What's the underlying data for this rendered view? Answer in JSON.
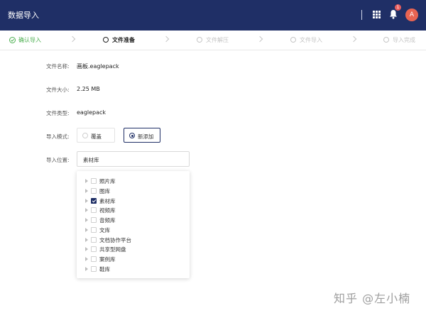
{
  "header": {
    "title": "数据导入",
    "notification_count": "1",
    "avatar_initial": "A",
    "colors": {
      "bg": "#1f2f66",
      "badge": "#e85d5d",
      "avatar": "#e86452"
    },
    "icons": [
      "grid-icon",
      "bell-icon"
    ]
  },
  "steps": [
    {
      "label": "确认导入",
      "state": "done"
    },
    {
      "label": "文件准备",
      "state": "active"
    },
    {
      "label": "文件解压",
      "state": "pending"
    },
    {
      "label": "文件导入",
      "state": "pending"
    },
    {
      "label": "导入完成",
      "state": "pending"
    }
  ],
  "form": {
    "file_name_label": "文件名称:",
    "file_name": "画板.eaglepack",
    "file_size_label": "文件大小:",
    "file_size": "2.25 MB",
    "file_type_label": "文件类型:",
    "file_type": "eaglepack",
    "mode_label": "导入模式:",
    "mode_options": [
      {
        "label": "覆盖",
        "selected": false
      },
      {
        "label": "新添加",
        "selected": true
      }
    ],
    "location_label": "导入位置:",
    "location_value": "素材库"
  },
  "tree": {
    "items": [
      {
        "label": "照片库",
        "checked": false
      },
      {
        "label": "图库",
        "checked": false
      },
      {
        "label": "素材库",
        "checked": true
      },
      {
        "label": "视频库",
        "checked": false
      },
      {
        "label": "音频库",
        "checked": false
      },
      {
        "label": "文库",
        "checked": false
      },
      {
        "label": "文档协作平台",
        "checked": false
      },
      {
        "label": "共享型网盘",
        "checked": false
      },
      {
        "label": "案例库",
        "checked": false
      },
      {
        "label": "鞋库",
        "checked": false
      }
    ]
  },
  "watermark": "知乎 @左小楠"
}
